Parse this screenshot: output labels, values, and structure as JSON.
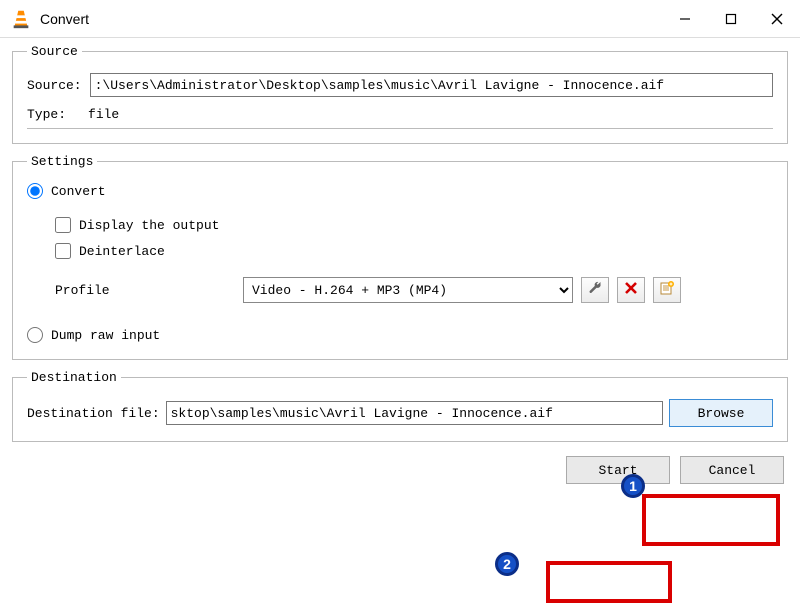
{
  "window": {
    "title": "Convert"
  },
  "source": {
    "legend": "Source",
    "label": "Source:",
    "path": ":\\Users\\Administrator\\Desktop\\samples\\music\\Avril Lavigne - Innocence.aif",
    "type_label": "Type:",
    "type_value": "file"
  },
  "settings": {
    "legend": "Settings",
    "convert_label": "Convert",
    "display_output_label": "Display the output",
    "deinterlace_label": "Deinterlace",
    "profile_label": "Profile",
    "profile_value": "Video - H.264 + MP3 (MP4)",
    "dump_label": "Dump raw input"
  },
  "destination": {
    "legend": "Destination",
    "label": "Destination file:",
    "path": "sktop\\samples\\music\\Avril Lavigne - Innocence.aif",
    "browse_label": "Browse"
  },
  "buttons": {
    "start": "Start",
    "cancel": "Cancel"
  },
  "annotations": {
    "badge1": "1",
    "badge2": "2"
  }
}
